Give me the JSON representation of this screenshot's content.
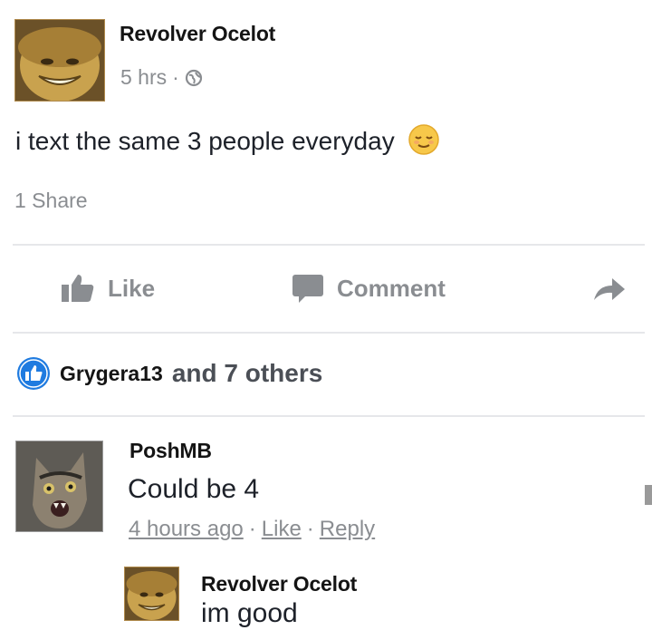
{
  "post": {
    "author": "Revolver Ocelot",
    "time": "5 hrs",
    "separator": "·",
    "text": "i text the same 3 people everyday",
    "emoji_icon": "relieved-face-emoji",
    "shares": "1 Share"
  },
  "actions": {
    "like": "Like",
    "comment": "Comment",
    "share_icon": "share-arrow-icon"
  },
  "reactions": {
    "first_name": "Grygera13",
    "others": "and 7 others"
  },
  "comments": [
    {
      "author": "PoshMB",
      "text": "Could be 4",
      "time": "4 hours ago",
      "like": "Like",
      "reply": "Reply"
    },
    {
      "author": "Revolver Ocelot",
      "text": "im good"
    }
  ],
  "colors": {
    "like_blue": "#1f7be0",
    "muted_gray": "#8a8d91",
    "text_dark": "#1d2129"
  }
}
